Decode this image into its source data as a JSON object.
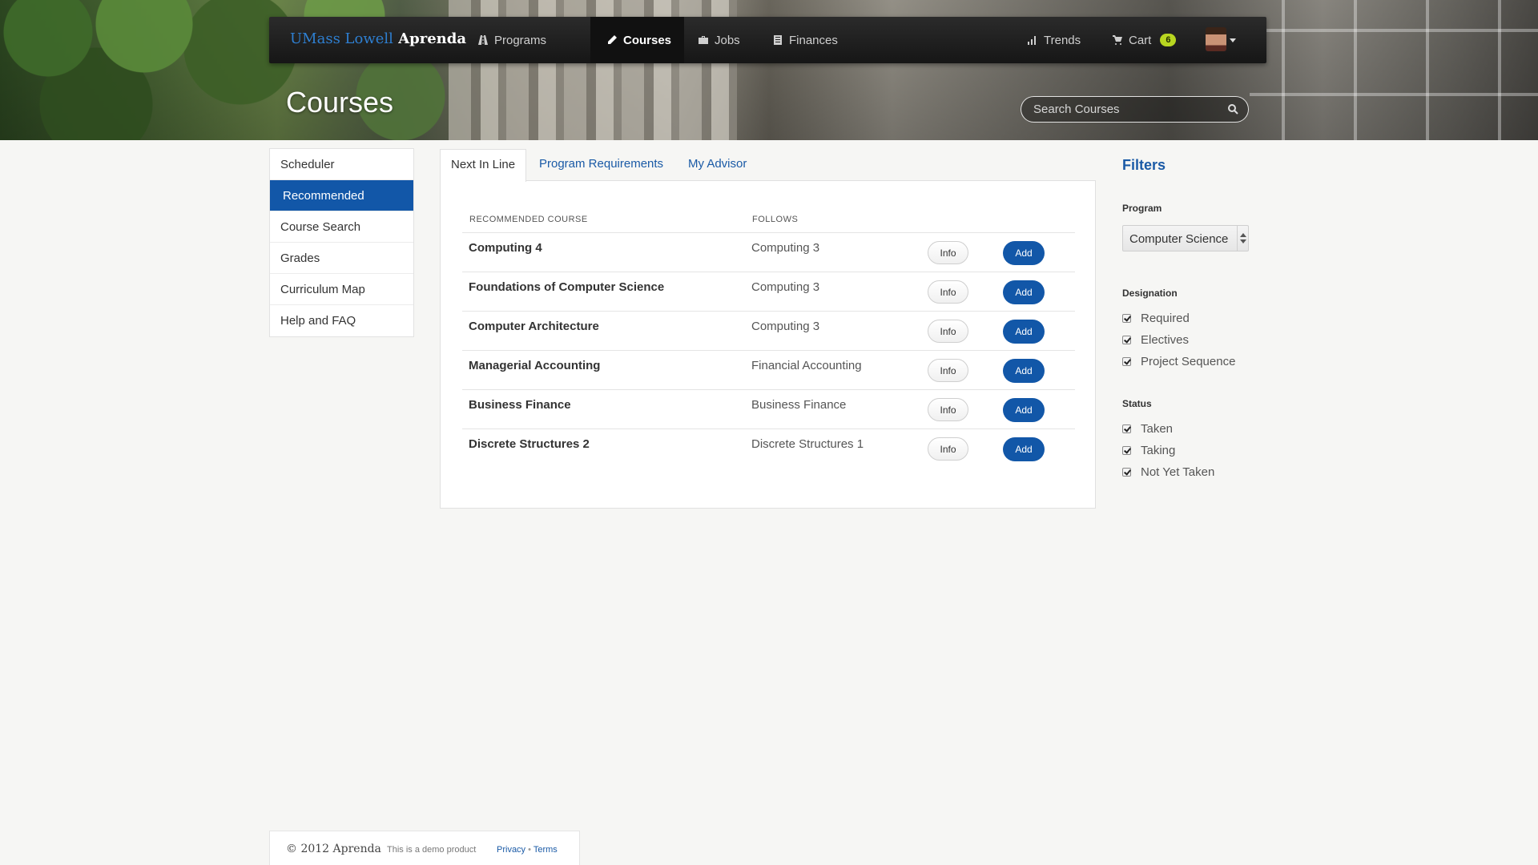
{
  "brand": {
    "school": "UMass Lowell",
    "product": "Aprenda"
  },
  "nav": {
    "items": [
      {
        "label": "Programs",
        "icon": "road-icon"
      },
      {
        "label": "Courses",
        "icon": "pencil-icon"
      },
      {
        "label": "Jobs",
        "icon": "briefcase-icon"
      },
      {
        "label": "Finances",
        "icon": "ledger-icon"
      }
    ],
    "trends": {
      "label": "Trends",
      "icon": "bar-chart-icon"
    },
    "cart": {
      "label": "Cart",
      "icon": "cart-icon",
      "count": "6"
    }
  },
  "page": {
    "title": "Courses"
  },
  "search": {
    "placeholder": "Search Courses"
  },
  "sidebar": {
    "items": [
      {
        "label": "Scheduler"
      },
      {
        "label": "Recommended"
      },
      {
        "label": "Course Search"
      },
      {
        "label": "Grades"
      },
      {
        "label": "Curriculum Map"
      },
      {
        "label": "Help and FAQ"
      }
    ],
    "active_index": 1
  },
  "tabs": [
    {
      "label": "Next In Line"
    },
    {
      "label": "Program Requirements"
    },
    {
      "label": "My Advisor"
    }
  ],
  "table": {
    "headers": {
      "course": "RECOMMENDED COURSE",
      "follows": "FOLLOWS"
    },
    "info_label": "Info",
    "add_label": "Add",
    "rows": [
      {
        "course": "Computing 4",
        "follows": "Computing 3"
      },
      {
        "course": "Foundations of Computer Science",
        "follows": "Computing 3"
      },
      {
        "course": "Computer Architecture",
        "follows": "Computing 3"
      },
      {
        "course": "Managerial Accounting",
        "follows": "Financial Accounting"
      },
      {
        "course": "Business Finance",
        "follows": "Business Finance"
      },
      {
        "course": "Discrete Structures 2",
        "follows": "Discrete Structures 1"
      }
    ]
  },
  "filters": {
    "title": "Filters",
    "program": {
      "label": "Program",
      "value": "Computer Science"
    },
    "designation": {
      "label": "Designation",
      "options": [
        {
          "label": "Required",
          "checked": true
        },
        {
          "label": "Electives",
          "checked": true
        },
        {
          "label": "Project Sequence",
          "checked": true
        }
      ]
    },
    "status": {
      "label": "Status",
      "options": [
        {
          "label": "Taken",
          "checked": true
        },
        {
          "label": "Taking",
          "checked": true
        },
        {
          "label": "Not Yet Taken",
          "checked": true
        }
      ]
    }
  },
  "footer": {
    "copyright": "© 2012 Aprenda",
    "note": "This is a demo product",
    "privacy": "Privacy",
    "separator": "•",
    "terms": "Terms"
  },
  "colors": {
    "accent": "#1257a8",
    "link": "#1a5aa6",
    "badge": "#b8d620",
    "navbar": "#1c1c1c"
  }
}
